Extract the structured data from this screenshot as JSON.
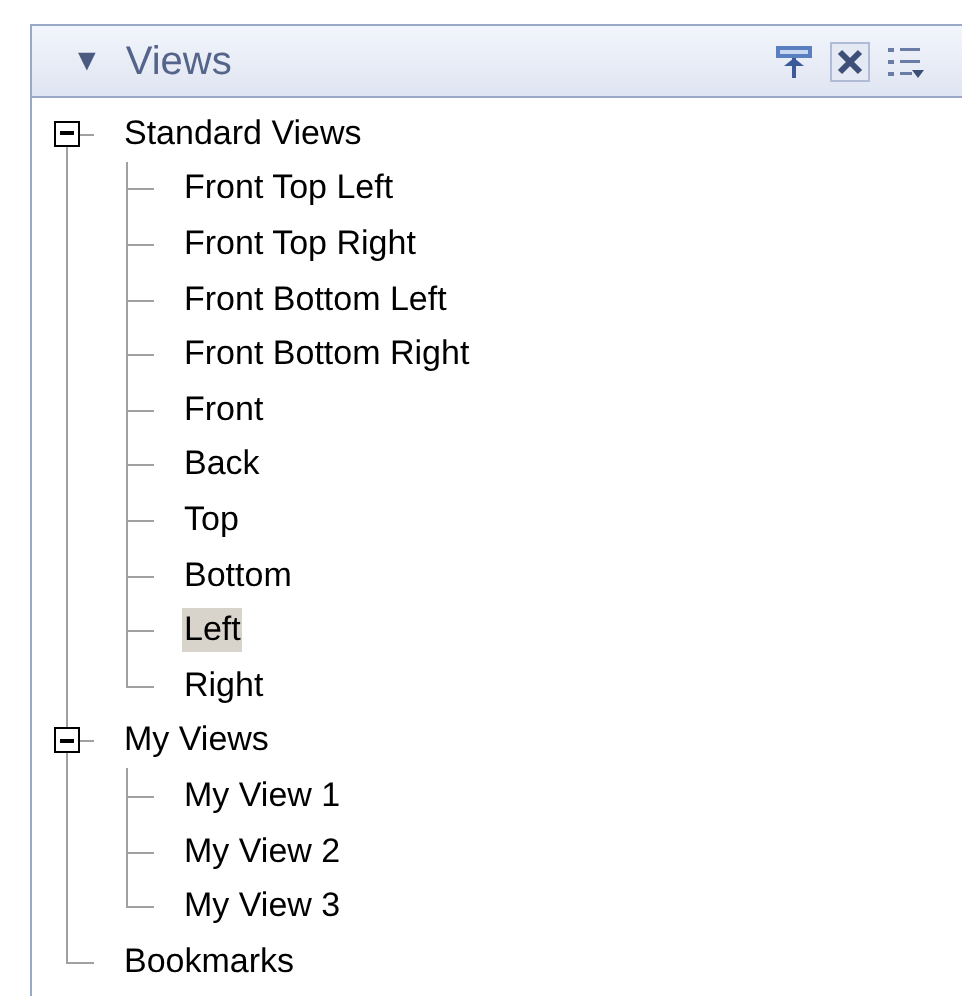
{
  "panel": {
    "title": "Views",
    "collapse_glyph": "▼",
    "expanded": true
  },
  "tree": [
    {
      "label": "Standard Views",
      "expanded": true,
      "selected": false,
      "children": [
        {
          "label": "Front Top Left",
          "selected": false
        },
        {
          "label": "Front Top Right",
          "selected": false
        },
        {
          "label": "Front Bottom Left",
          "selected": false
        },
        {
          "label": "Front Bottom Right",
          "selected": false
        },
        {
          "label": "Front",
          "selected": false
        },
        {
          "label": "Back",
          "selected": false
        },
        {
          "label": "Top",
          "selected": false
        },
        {
          "label": "Bottom",
          "selected": false
        },
        {
          "label": "Left",
          "selected": true
        },
        {
          "label": "Right",
          "selected": false
        }
      ]
    },
    {
      "label": "My Views",
      "expanded": true,
      "selected": false,
      "children": [
        {
          "label": "My View 1",
          "selected": false
        },
        {
          "label": "My View 2",
          "selected": false
        },
        {
          "label": "My View 3",
          "selected": false
        }
      ]
    },
    {
      "label": "Bookmarks",
      "selected": false
    }
  ]
}
